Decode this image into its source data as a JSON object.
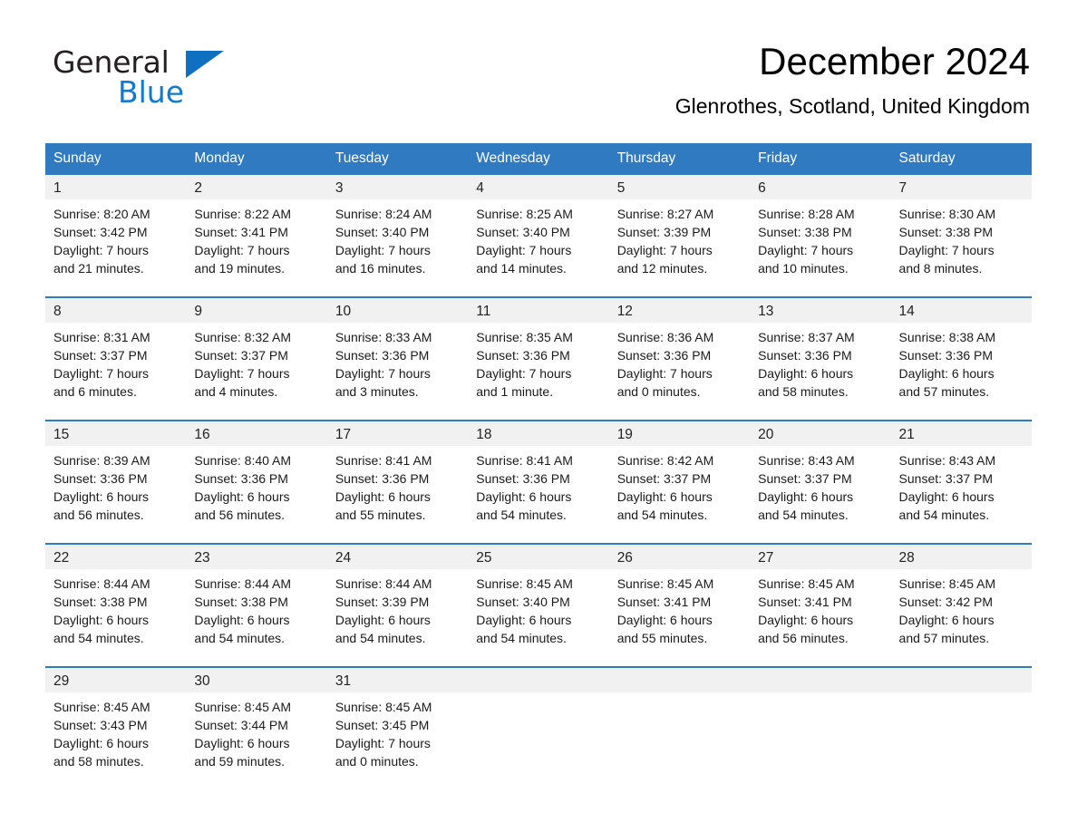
{
  "brand": {
    "name_part1": "General",
    "name_part2": "Blue",
    "triangle_color": "#0f6fc0",
    "blue_text_color": "#0f7ad1"
  },
  "header": {
    "month_title": "December 2024",
    "location": "Glenrothes, Scotland, United Kingdom"
  },
  "theme": {
    "header_blue": "#2f7ac0",
    "daynum_band": "#f1f1f1",
    "separator_blue": "#2f7ac0"
  },
  "weekdays": [
    "Sunday",
    "Monday",
    "Tuesday",
    "Wednesday",
    "Thursday",
    "Friday",
    "Saturday"
  ],
  "weeks": [
    {
      "days": [
        {
          "date": "1",
          "sunrise": "Sunrise: 8:20 AM",
          "sunset": "Sunset: 3:42 PM",
          "daylight_line1": "Daylight: 7 hours",
          "daylight_line2": "and 21 minutes."
        },
        {
          "date": "2",
          "sunrise": "Sunrise: 8:22 AM",
          "sunset": "Sunset: 3:41 PM",
          "daylight_line1": "Daylight: 7 hours",
          "daylight_line2": "and 19 minutes."
        },
        {
          "date": "3",
          "sunrise": "Sunrise: 8:24 AM",
          "sunset": "Sunset: 3:40 PM",
          "daylight_line1": "Daylight: 7 hours",
          "daylight_line2": "and 16 minutes."
        },
        {
          "date": "4",
          "sunrise": "Sunrise: 8:25 AM",
          "sunset": "Sunset: 3:40 PM",
          "daylight_line1": "Daylight: 7 hours",
          "daylight_line2": "and 14 minutes."
        },
        {
          "date": "5",
          "sunrise": "Sunrise: 8:27 AM",
          "sunset": "Sunset: 3:39 PM",
          "daylight_line1": "Daylight: 7 hours",
          "daylight_line2": "and 12 minutes."
        },
        {
          "date": "6",
          "sunrise": "Sunrise: 8:28 AM",
          "sunset": "Sunset: 3:38 PM",
          "daylight_line1": "Daylight: 7 hours",
          "daylight_line2": "and 10 minutes."
        },
        {
          "date": "7",
          "sunrise": "Sunrise: 8:30 AM",
          "sunset": "Sunset: 3:38 PM",
          "daylight_line1": "Daylight: 7 hours",
          "daylight_line2": "and 8 minutes."
        }
      ]
    },
    {
      "days": [
        {
          "date": "8",
          "sunrise": "Sunrise: 8:31 AM",
          "sunset": "Sunset: 3:37 PM",
          "daylight_line1": "Daylight: 7 hours",
          "daylight_line2": "and 6 minutes."
        },
        {
          "date": "9",
          "sunrise": "Sunrise: 8:32 AM",
          "sunset": "Sunset: 3:37 PM",
          "daylight_line1": "Daylight: 7 hours",
          "daylight_line2": "and 4 minutes."
        },
        {
          "date": "10",
          "sunrise": "Sunrise: 8:33 AM",
          "sunset": "Sunset: 3:36 PM",
          "daylight_line1": "Daylight: 7 hours",
          "daylight_line2": "and 3 minutes."
        },
        {
          "date": "11",
          "sunrise": "Sunrise: 8:35 AM",
          "sunset": "Sunset: 3:36 PM",
          "daylight_line1": "Daylight: 7 hours",
          "daylight_line2": "and 1 minute."
        },
        {
          "date": "12",
          "sunrise": "Sunrise: 8:36 AM",
          "sunset": "Sunset: 3:36 PM",
          "daylight_line1": "Daylight: 7 hours",
          "daylight_line2": "and 0 minutes."
        },
        {
          "date": "13",
          "sunrise": "Sunrise: 8:37 AM",
          "sunset": "Sunset: 3:36 PM",
          "daylight_line1": "Daylight: 6 hours",
          "daylight_line2": "and 58 minutes."
        },
        {
          "date": "14",
          "sunrise": "Sunrise: 8:38 AM",
          "sunset": "Sunset: 3:36 PM",
          "daylight_line1": "Daylight: 6 hours",
          "daylight_line2": "and 57 minutes."
        }
      ]
    },
    {
      "days": [
        {
          "date": "15",
          "sunrise": "Sunrise: 8:39 AM",
          "sunset": "Sunset: 3:36 PM",
          "daylight_line1": "Daylight: 6 hours",
          "daylight_line2": "and 56 minutes."
        },
        {
          "date": "16",
          "sunrise": "Sunrise: 8:40 AM",
          "sunset": "Sunset: 3:36 PM",
          "daylight_line1": "Daylight: 6 hours",
          "daylight_line2": "and 56 minutes."
        },
        {
          "date": "17",
          "sunrise": "Sunrise: 8:41 AM",
          "sunset": "Sunset: 3:36 PM",
          "daylight_line1": "Daylight: 6 hours",
          "daylight_line2": "and 55 minutes."
        },
        {
          "date": "18",
          "sunrise": "Sunrise: 8:41 AM",
          "sunset": "Sunset: 3:36 PM",
          "daylight_line1": "Daylight: 6 hours",
          "daylight_line2": "and 54 minutes."
        },
        {
          "date": "19",
          "sunrise": "Sunrise: 8:42 AM",
          "sunset": "Sunset: 3:37 PM",
          "daylight_line1": "Daylight: 6 hours",
          "daylight_line2": "and 54 minutes."
        },
        {
          "date": "20",
          "sunrise": "Sunrise: 8:43 AM",
          "sunset": "Sunset: 3:37 PM",
          "daylight_line1": "Daylight: 6 hours",
          "daylight_line2": "and 54 minutes."
        },
        {
          "date": "21",
          "sunrise": "Sunrise: 8:43 AM",
          "sunset": "Sunset: 3:37 PM",
          "daylight_line1": "Daylight: 6 hours",
          "daylight_line2": "and 54 minutes."
        }
      ]
    },
    {
      "days": [
        {
          "date": "22",
          "sunrise": "Sunrise: 8:44 AM",
          "sunset": "Sunset: 3:38 PM",
          "daylight_line1": "Daylight: 6 hours",
          "daylight_line2": "and 54 minutes."
        },
        {
          "date": "23",
          "sunrise": "Sunrise: 8:44 AM",
          "sunset": "Sunset: 3:38 PM",
          "daylight_line1": "Daylight: 6 hours",
          "daylight_line2": "and 54 minutes."
        },
        {
          "date": "24",
          "sunrise": "Sunrise: 8:44 AM",
          "sunset": "Sunset: 3:39 PM",
          "daylight_line1": "Daylight: 6 hours",
          "daylight_line2": "and 54 minutes."
        },
        {
          "date": "25",
          "sunrise": "Sunrise: 8:45 AM",
          "sunset": "Sunset: 3:40 PM",
          "daylight_line1": "Daylight: 6 hours",
          "daylight_line2": "and 54 minutes."
        },
        {
          "date": "26",
          "sunrise": "Sunrise: 8:45 AM",
          "sunset": "Sunset: 3:41 PM",
          "daylight_line1": "Daylight: 6 hours",
          "daylight_line2": "and 55 minutes."
        },
        {
          "date": "27",
          "sunrise": "Sunrise: 8:45 AM",
          "sunset": "Sunset: 3:41 PM",
          "daylight_line1": "Daylight: 6 hours",
          "daylight_line2": "and 56 minutes."
        },
        {
          "date": "28",
          "sunrise": "Sunrise: 8:45 AM",
          "sunset": "Sunset: 3:42 PM",
          "daylight_line1": "Daylight: 6 hours",
          "daylight_line2": "and 57 minutes."
        }
      ]
    },
    {
      "days": [
        {
          "date": "29",
          "sunrise": "Sunrise: 8:45 AM",
          "sunset": "Sunset: 3:43 PM",
          "daylight_line1": "Daylight: 6 hours",
          "daylight_line2": "and 58 minutes."
        },
        {
          "date": "30",
          "sunrise": "Sunrise: 8:45 AM",
          "sunset": "Sunset: 3:44 PM",
          "daylight_line1": "Daylight: 6 hours",
          "daylight_line2": "and 59 minutes."
        },
        {
          "date": "31",
          "sunrise": "Sunrise: 8:45 AM",
          "sunset": "Sunset: 3:45 PM",
          "daylight_line1": "Daylight: 7 hours",
          "daylight_line2": "and 0 minutes."
        },
        {
          "date": "",
          "sunrise": "",
          "sunset": "",
          "daylight_line1": "",
          "daylight_line2": ""
        },
        {
          "date": "",
          "sunrise": "",
          "sunset": "",
          "daylight_line1": "",
          "daylight_line2": ""
        },
        {
          "date": "",
          "sunrise": "",
          "sunset": "",
          "daylight_line1": "",
          "daylight_line2": ""
        },
        {
          "date": "",
          "sunrise": "",
          "sunset": "",
          "daylight_line1": "",
          "daylight_line2": ""
        }
      ]
    }
  ]
}
